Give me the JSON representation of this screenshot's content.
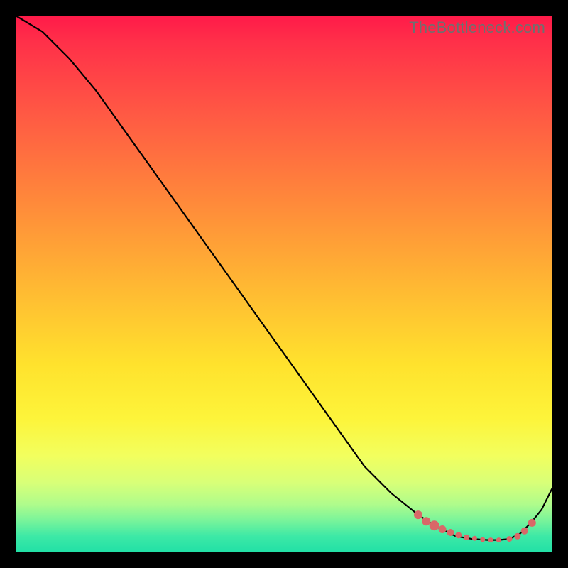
{
  "watermark": "TheBottleneck.com",
  "chart_data": {
    "type": "line",
    "title": "",
    "xlabel": "",
    "ylabel": "",
    "xlim": [
      0,
      100
    ],
    "ylim": [
      0,
      100
    ],
    "grid": false,
    "series": [
      {
        "name": "curve",
        "x": [
          0,
          5,
          10,
          15,
          20,
          25,
          30,
          35,
          40,
          45,
          50,
          55,
          60,
          65,
          70,
          75,
          78,
          80,
          82,
          85,
          88,
          90,
          92,
          94,
          96,
          98,
          100
        ],
        "values": [
          100,
          97,
          92,
          86,
          79,
          72,
          65,
          58,
          51,
          44,
          37,
          30,
          23,
          16,
          11,
          7,
          5,
          4,
          3,
          2.5,
          2.3,
          2.3,
          2.5,
          3.5,
          5.5,
          8,
          12
        ]
      }
    ],
    "scatter_points": {
      "name": "highlighted-points",
      "color": "#d96868",
      "points": [
        {
          "x": 75,
          "y": 7,
          "size": 6
        },
        {
          "x": 76.5,
          "y": 5.8,
          "size": 6
        },
        {
          "x": 78,
          "y": 5,
          "size": 7
        },
        {
          "x": 79.5,
          "y": 4.3,
          "size": 5.5
        },
        {
          "x": 81,
          "y": 3.7,
          "size": 5
        },
        {
          "x": 82.5,
          "y": 3.2,
          "size": 4.5
        },
        {
          "x": 84,
          "y": 2.8,
          "size": 4
        },
        {
          "x": 85.5,
          "y": 2.6,
          "size": 3.5
        },
        {
          "x": 87,
          "y": 2.4,
          "size": 3.5
        },
        {
          "x": 88.5,
          "y": 2.3,
          "size": 3.5
        },
        {
          "x": 90,
          "y": 2.3,
          "size": 3.5
        },
        {
          "x": 92,
          "y": 2.5,
          "size": 4
        },
        {
          "x": 93.5,
          "y": 3,
          "size": 4.5
        },
        {
          "x": 94.8,
          "y": 4,
          "size": 5
        },
        {
          "x": 96.2,
          "y": 5.5,
          "size": 5.5
        }
      ]
    }
  }
}
